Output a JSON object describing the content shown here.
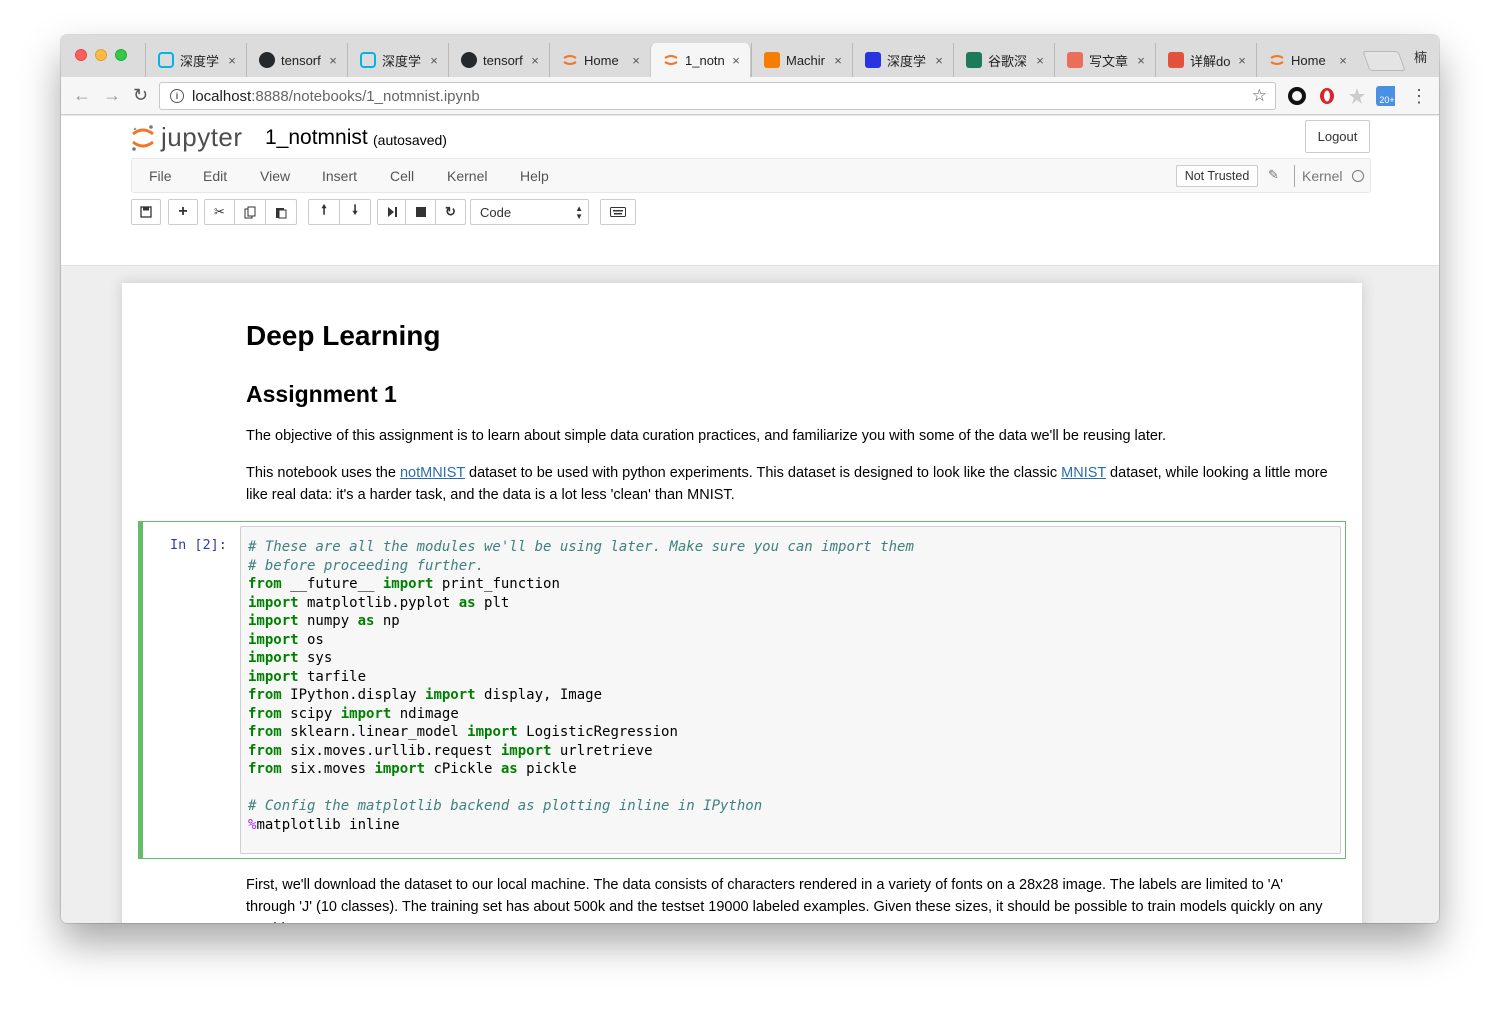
{
  "browser": {
    "tabs": [
      {
        "title": "深度学",
        "icon": "udacity-icon",
        "icon_color": "#02b3e4"
      },
      {
        "title": "tensorf",
        "icon": "github-icon",
        "icon_color": "#24292e"
      },
      {
        "title": "深度学",
        "icon": "udacity-icon",
        "icon_color": "#02b3e4"
      },
      {
        "title": "tensorf",
        "icon": "github-icon",
        "icon_color": "#24292e"
      },
      {
        "title": "Home",
        "icon": "jupyter-icon",
        "icon_color": "#f37626"
      },
      {
        "title": "1_notn",
        "icon": "jupyter-icon",
        "icon_color": "#f37626",
        "active": true
      },
      {
        "title": "Machir",
        "icon": "blogger-icon",
        "icon_color": "#f57d00"
      },
      {
        "title": "深度学",
        "icon": "baidu-icon",
        "icon_color": "#2932e1"
      },
      {
        "title": "谷歌深",
        "icon": "bird-icon",
        "icon_color": "#1e7b5a"
      },
      {
        "title": "写文章",
        "icon": "jianshu-icon",
        "icon_color": "#ea6f5a"
      },
      {
        "title": "详解do",
        "icon": "b-icon",
        "icon_color": "#e2523a"
      },
      {
        "title": "Home",
        "icon": "jupyter-icon",
        "icon_color": "#f37626"
      }
    ],
    "close_glyph": "×",
    "profile": "楠",
    "url_host": "localhost",
    "url_path": ":8888/notebooks/1_notmnist.ipynb"
  },
  "jupyter": {
    "logo_text": "jupyter",
    "notebook_name": "1_notmnist",
    "autosave_status": "(autosaved)",
    "logout_label": "Logout",
    "menu": [
      "File",
      "Edit",
      "View",
      "Insert",
      "Cell",
      "Kernel",
      "Help"
    ],
    "trust_label": "Not Trusted",
    "kernel_label": "Kernel",
    "cell_type": "Code"
  },
  "notebook": {
    "title": "Deep Learning",
    "subtitle": "Assignment 1",
    "para1": "The objective of this assignment is to learn about simple data curation practices, and familiarize you with some of the data we'll be reusing later.",
    "para2_a": "This notebook uses the ",
    "para2_link1": "notMNIST",
    "para2_b": " dataset to be used with python experiments. This dataset is designed to look like the classic ",
    "para2_link2": "MNIST",
    "para2_c": " dataset, while looking a little more like real data: it's a harder task, and the data is a lot less 'clean' than MNIST.",
    "prompt": "In [2]:",
    "code": {
      "l1": "# These are all the modules we'll be using later. Make sure you can import them",
      "l2": "# before proceeding further.",
      "l3_kw1": "from",
      "l3_a": " __future__ ",
      "l3_kw2": "import",
      "l3_b": " print_function",
      "l4_kw1": "import",
      "l4_a": " matplotlib.pyplot ",
      "l4_kw2": "as",
      "l4_b": " plt",
      "l5_kw1": "import",
      "l5_a": " numpy ",
      "l5_kw2": "as",
      "l5_b": " np",
      "l6_kw1": "import",
      "l6_a": " os",
      "l7_kw1": "import",
      "l7_a": " sys",
      "l8_kw1": "import",
      "l8_a": " tarfile",
      "l9_kw1": "from",
      "l9_a": " IPython.display ",
      "l9_kw2": "import",
      "l9_b": " display, Image",
      "l10_kw1": "from",
      "l10_a": " scipy ",
      "l10_kw2": "import",
      "l10_b": " ndimage",
      "l11_kw1": "from",
      "l11_a": " sklearn.linear_model ",
      "l11_kw2": "import",
      "l11_b": " LogisticRegression",
      "l12_kw1": "from",
      "l12_a": " six.moves.urllib.request ",
      "l12_kw2": "import",
      "l12_b": " urlretrieve",
      "l13_kw1": "from",
      "l13_a": " six.moves ",
      "l13_kw2": "import",
      "l13_b": " cPickle ",
      "l13_kw3": "as",
      "l13_c": " pickle",
      "l15": "# Config the matplotlib backend as plotting inline in IPython",
      "l16_mg": "%",
      "l16_a": "matplotlib inline"
    },
    "para3": "First, we'll download the dataset to our local machine. The data consists of characters rendered in a variety of fonts on a 28x28 image. The labels are limited to 'A' through 'J' (10 classes). The training set has about 500k and the testset 19000 labeled examples. Given these sizes, it should be possible to train models quickly on any machine."
  }
}
